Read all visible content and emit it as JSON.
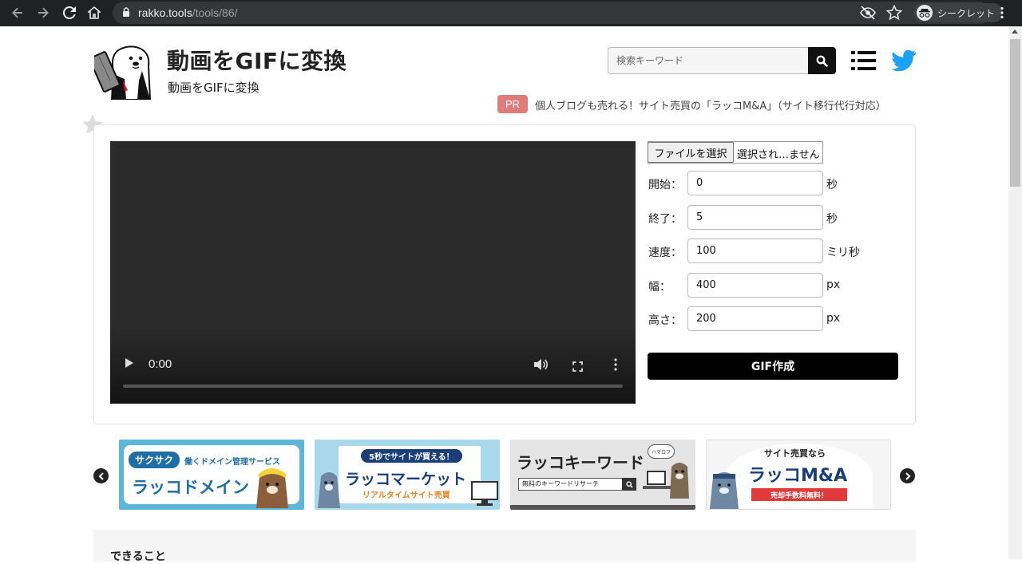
{
  "browser": {
    "url_host": "rakko.tools",
    "url_path": "/tools/86/",
    "incognito_label": "シークレット"
  },
  "header": {
    "title": "動画をGIFに変換",
    "subtitle": "動画をGIFに変換",
    "search_placeholder": "検索キーワード",
    "pr_badge": "PR",
    "pr_text": "個人ブログも売れる！サイト売買の「ラッコM&A」（サイト移行代行対応）"
  },
  "video": {
    "time": "0:00"
  },
  "form": {
    "file_button": "ファイルを選択",
    "file_status": "選択され…ません",
    "fields": [
      {
        "label": "開始：",
        "value": "0",
        "unit": "秒"
      },
      {
        "label": "終了：",
        "value": "5",
        "unit": "秒"
      },
      {
        "label": "速度：",
        "value": "100",
        "unit": "ミリ秒"
      },
      {
        "label": "幅：",
        "value": "400",
        "unit": "px"
      },
      {
        "label": "高さ：",
        "value": "200",
        "unit": "px"
      }
    ],
    "submit": "GIF作成"
  },
  "carousel": {
    "banners": [
      {
        "tag": "サクサク",
        "tagline": "働くドメイン管理サービス",
        "title": "ラッコドメイン",
        "bg": "#5bb6d8"
      },
      {
        "tag": "5秒でサイトが買える！",
        "title": "ラッコマーケット",
        "sub": "リアルタイムサイト売買",
        "bg": "#a9d7ec"
      },
      {
        "title": "ラッコキーワード",
        "sub": "無料のキーワードリサーチ",
        "bubble": "ハマロフ",
        "bg": "#e4e4e4"
      },
      {
        "top": "サイト売買なら",
        "title": "ラッコM&A",
        "ribbon": "売却手数料無料！",
        "bg": "#f5f5f5"
      }
    ]
  },
  "section": {
    "heading": "できること"
  },
  "colors": {
    "chrome": "#202124",
    "pr_badge": "#e07b7b",
    "twitter": "#1da1f2",
    "button": "#000000"
  }
}
